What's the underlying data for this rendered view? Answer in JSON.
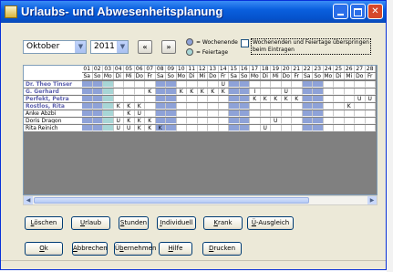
{
  "window": {
    "title": "Urlaubs- und Abwesenheitsplanung"
  },
  "controls": {
    "month": "Oktober",
    "year": "2011",
    "prev_label": "«",
    "next_label": "»",
    "legend_weekend": "= Wochenende",
    "legend_holiday": "= Feiertage",
    "skip_option": "Wochenenden und Feiertage überspringen beim Eintragen",
    "skip_option_line1": "Wochenenden und Feiertage überspringen",
    "skip_option_line2": "beim Eintragen"
  },
  "colors": {
    "weekend": "#8ea2d8",
    "holiday": "#a7d6d6",
    "window_frame": "#0a5fde"
  },
  "calendar": {
    "days": [
      {
        "num": "01",
        "dow": "Sa",
        "weekend": true
      },
      {
        "num": "02",
        "dow": "So",
        "weekend": true
      },
      {
        "num": "03",
        "dow": "Mo",
        "holiday": true
      },
      {
        "num": "04",
        "dow": "Di"
      },
      {
        "num": "05",
        "dow": "Mi"
      },
      {
        "num": "06",
        "dow": "Do"
      },
      {
        "num": "07",
        "dow": "Fr"
      },
      {
        "num": "08",
        "dow": "Sa",
        "weekend": true
      },
      {
        "num": "09",
        "dow": "So",
        "weekend": true
      },
      {
        "num": "10",
        "dow": "Mo"
      },
      {
        "num": "11",
        "dow": "Di"
      },
      {
        "num": "12",
        "dow": "Mi"
      },
      {
        "num": "13",
        "dow": "Do"
      },
      {
        "num": "14",
        "dow": "Fr"
      },
      {
        "num": "15",
        "dow": "Sa",
        "weekend": true
      },
      {
        "num": "16",
        "dow": "So",
        "weekend": true
      },
      {
        "num": "17",
        "dow": "Mo"
      },
      {
        "num": "18",
        "dow": "Di"
      },
      {
        "num": "19",
        "dow": "Mi"
      },
      {
        "num": "20",
        "dow": "Do"
      },
      {
        "num": "21",
        "dow": "Fr"
      },
      {
        "num": "22",
        "dow": "Sa",
        "weekend": true
      },
      {
        "num": "23",
        "dow": "So",
        "weekend": true
      },
      {
        "num": "24",
        "dow": "Mo"
      },
      {
        "num": "25",
        "dow": "Di"
      },
      {
        "num": "26",
        "dow": "Mi"
      },
      {
        "num": "27",
        "dow": "Do"
      },
      {
        "num": "28",
        "dow": "Fr"
      }
    ],
    "employees": [
      {
        "name": "Dr. Theo Tinser",
        "highlight": true,
        "marks": {
          "14": "U"
        }
      },
      {
        "name": "G. Gerhard",
        "highlight": true,
        "marks": {
          "07": "K",
          "10": "K",
          "11": "K",
          "12": "K",
          "13": "K",
          "14": "K",
          "17": "I",
          "20": "U"
        }
      },
      {
        "name": "Perfekt, Petra",
        "highlight": true,
        "marks": {
          "17": "K",
          "18": "K",
          "19": "K",
          "20": "K",
          "21": "K",
          "27": "U",
          "28": "U"
        }
      },
      {
        "name": "Rostlos, Rita",
        "highlight": true,
        "marks": {
          "04": "K",
          "05": "K",
          "06": "K",
          "26": "K"
        }
      },
      {
        "name": "Anke Abzbi",
        "highlight": false,
        "marks": {
          "05": "K",
          "06": "U"
        }
      },
      {
        "name": "Doris Dragon",
        "highlight": false,
        "marks": {
          "04": "U",
          "05": "K",
          "06": "K",
          "07": "K",
          "19": "U"
        }
      },
      {
        "name": "Rita Reinich",
        "highlight": false,
        "marks": {
          "04": "U",
          "05": "U",
          "06": "K",
          "07": "K",
          "08": "K",
          "18": "U"
        }
      }
    ]
  },
  "buttons_row1": [
    {
      "pre": "",
      "key": "L",
      "post": "öschen"
    },
    {
      "pre": "",
      "key": "U",
      "post": "rlaub"
    },
    {
      "pre": "",
      "key": "S",
      "post": "tunden"
    },
    {
      "pre": "",
      "key": "I",
      "post": "ndividuell"
    },
    {
      "pre": "",
      "key": "K",
      "post": "rank"
    },
    {
      "pre": "",
      "key": "Ü",
      "post": "-Ausgleich"
    }
  ],
  "buttons_row2": [
    {
      "pre": "",
      "key": "O",
      "post": "k"
    },
    {
      "pre": "",
      "key": "A",
      "post": "bbrechen"
    },
    {
      "pre": "Ü",
      "key": "b",
      "post": "ernehmen"
    },
    {
      "pre": "",
      "key": "H",
      "post": "ilfe"
    },
    {
      "pre": "",
      "key": "D",
      "post": "rucken"
    }
  ]
}
